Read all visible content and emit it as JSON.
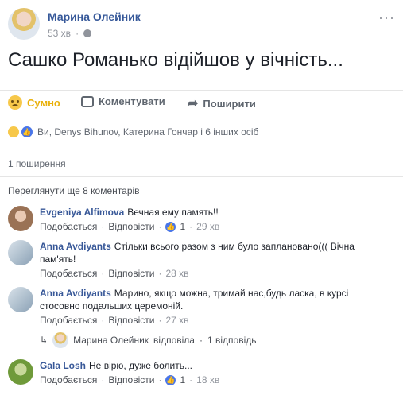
{
  "post": {
    "author": "Марина Олейник",
    "time": "53 хв",
    "separator": "·",
    "text": "Сашко Романько відійшов у вічність...",
    "menu": "···"
  },
  "actions": {
    "reaction": "Сумно",
    "comment": "Коментувати",
    "share": "Поширити"
  },
  "reactions": {
    "names": "Ви, Denys Bihunov, Катерина Гончар і 6 інших осіб"
  },
  "shares": "1 поширення",
  "prev_comments": "Переглянути ще 8 коментарів",
  "comments": [
    {
      "name": "Evgeniya Alfimova",
      "text": "Вечная ему память!!",
      "like": "Подобається",
      "reply": "Відповісти",
      "likes": "1",
      "time": "29 хв"
    },
    {
      "name": "Anna Avdiyants",
      "text": "Стільки всього разом з ним було заплановано((( Вічна пам'ять!",
      "like": "Подобається",
      "reply": "Відповісти",
      "likes": "",
      "time": "28 хв"
    },
    {
      "name": "Anna Avdiyants",
      "text": "Марино, якщо можна, тримай нас,будь ласка, в курсі стосовно подальших церемоній.",
      "like": "Подобається",
      "reply": "Відповісти",
      "likes": "",
      "time": "27 хв"
    },
    {
      "name": "Gala Losh",
      "text": "Не вірю, дуже болить...",
      "like": "Подобається",
      "reply": "Відповісти",
      "likes": "1",
      "time": "18 хв"
    }
  ],
  "reply_info": {
    "name": "Марина Олейник",
    "action": "відповіла",
    "count": "1 відповідь"
  },
  "colors": {
    "link": "#385898",
    "sad": "#e9b10c",
    "like": "#4a76e8"
  }
}
